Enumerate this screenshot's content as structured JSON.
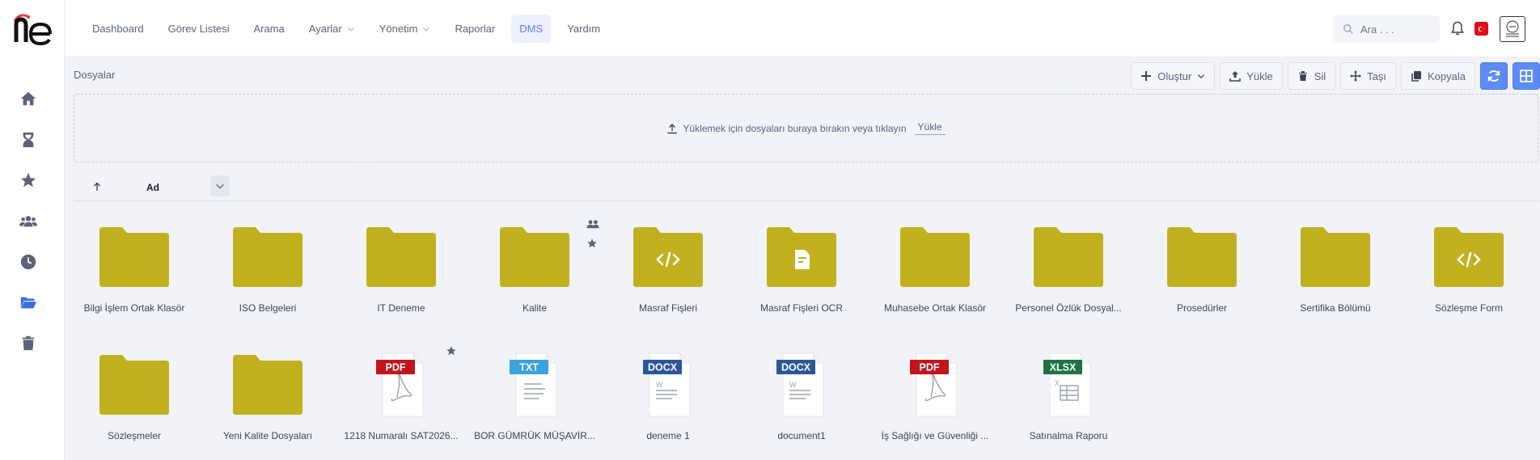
{
  "nav": {
    "items": [
      {
        "label": "Dashboard",
        "dropdown": false,
        "active": false
      },
      {
        "label": "Görev Listesi",
        "dropdown": false,
        "active": false
      },
      {
        "label": "Arama",
        "dropdown": false,
        "active": false
      },
      {
        "label": "Ayarlar",
        "dropdown": true,
        "active": false
      },
      {
        "label": "Yönetim",
        "dropdown": true,
        "active": false
      },
      {
        "label": "Raporlar",
        "dropdown": false,
        "active": false
      },
      {
        "label": "DMS",
        "dropdown": false,
        "active": true
      },
      {
        "label": "Yardım",
        "dropdown": false,
        "active": false
      }
    ]
  },
  "search": {
    "placeholder": "Ara . . ."
  },
  "sidebar": {
    "icons": [
      "home-icon",
      "hourglass-icon",
      "star-icon",
      "users-icon",
      "clock-icon",
      "folder-open-icon",
      "trash-icon"
    ]
  },
  "breadcrumb": "Dosyalar",
  "toolbar": {
    "create": "Oluştur",
    "upload": "Yükle",
    "delete": "Sil",
    "move": "Taşı",
    "copy": "Kopyala"
  },
  "dropzone": {
    "text": "Yüklemek için dosyaları buraya bırakın veya tıklayın",
    "link": "Yükle"
  },
  "sort": {
    "label": "Ad"
  },
  "colors": {
    "folder": "#c2b11f",
    "accent": "#5d78ff",
    "pdf": "#c0151b",
    "txt": "#3aa3dc",
    "docx": "#2b5797",
    "xlsx": "#1f7244"
  },
  "items": [
    {
      "name": "Bilgi İşlem Ortak Klasör",
      "kind": "folder"
    },
    {
      "name": "ISO Belgeleri",
      "kind": "folder"
    },
    {
      "name": "IT Deneme",
      "kind": "folder"
    },
    {
      "name": "Kalite",
      "kind": "folder",
      "shared": true,
      "starred": true
    },
    {
      "name": "Masraf Fişleri",
      "kind": "folder-code"
    },
    {
      "name": "Masraf Fişleri OCR",
      "kind": "folder-doc"
    },
    {
      "name": "Muhasebe Ortak Klasör",
      "kind": "folder"
    },
    {
      "name": "Personel Özlük Dosyal...",
      "kind": "folder"
    },
    {
      "name": "Prosedürler",
      "kind": "folder"
    },
    {
      "name": "Sertifika Bölümü",
      "kind": "folder"
    },
    {
      "name": "Sözleşme Form",
      "kind": "folder-code"
    },
    {
      "name": "Sözleşmeler",
      "kind": "folder"
    },
    {
      "name": "Yeni Kalite Dosyaları",
      "kind": "folder"
    },
    {
      "name": "1218 Numaralı SAT2026...",
      "kind": "file",
      "ext": "PDF",
      "starred": true
    },
    {
      "name": "BOR GÜMRÜK MÜŞAVİR...",
      "kind": "file",
      "ext": "TXT"
    },
    {
      "name": "deneme 1",
      "kind": "file",
      "ext": "DOCX"
    },
    {
      "name": "document1",
      "kind": "file",
      "ext": "DOCX"
    },
    {
      "name": "İş Sağlığı ve Güvenliği ...",
      "kind": "file",
      "ext": "PDF"
    },
    {
      "name": "Satınalma Raporu",
      "kind": "file",
      "ext": "XLSX"
    }
  ]
}
